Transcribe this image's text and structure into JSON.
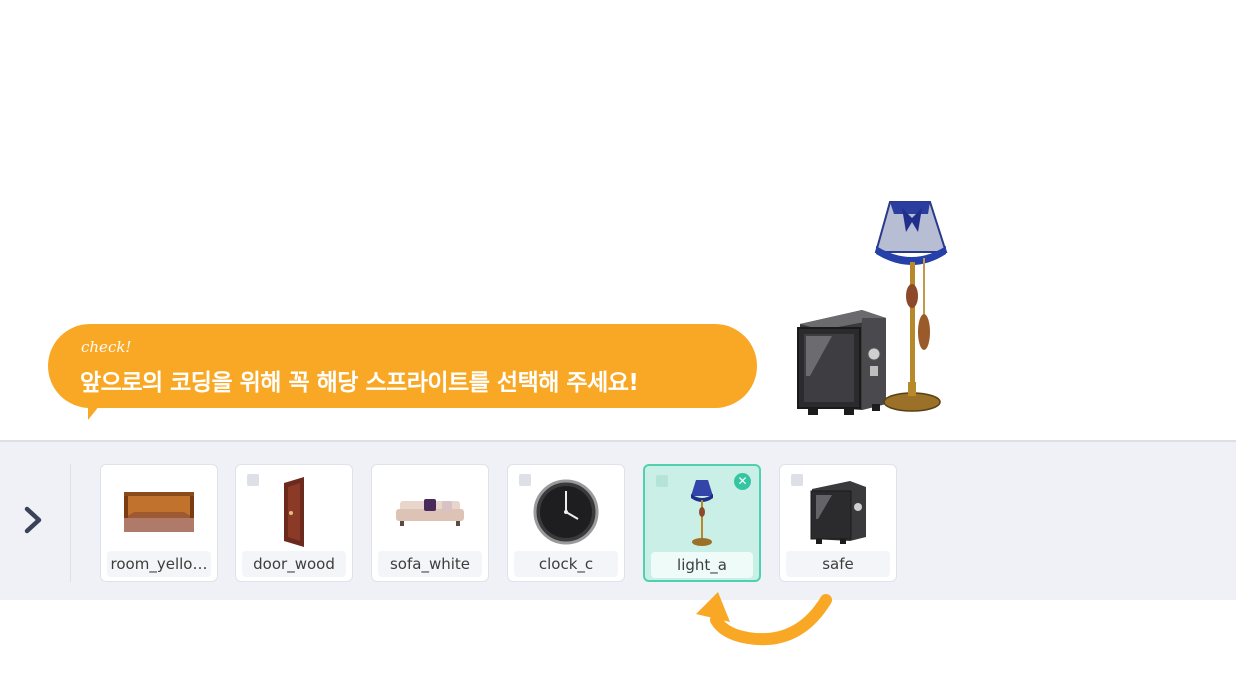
{
  "bubble": {
    "check_label": "check!",
    "message": "앞으로의 코딩을 위해 꼭 해당 스프라이트를 선택해 주세요!"
  },
  "sprites": [
    {
      "name": "room_yello…",
      "icon": "room-thumbnail-icon",
      "selected": false
    },
    {
      "name": "door_wood",
      "icon": "door-thumbnail-icon",
      "selected": false
    },
    {
      "name": "sofa_white",
      "icon": "sofa-thumbnail-icon",
      "selected": false
    },
    {
      "name": "clock_c",
      "icon": "clock-thumbnail-icon",
      "selected": false
    },
    {
      "name": "light_a",
      "icon": "lamp-thumbnail-icon",
      "selected": true
    },
    {
      "name": "safe",
      "icon": "safe-thumbnail-icon",
      "selected": false
    }
  ],
  "colors": {
    "bubble": "#f9a825",
    "selected_card": "#c9efe7",
    "selected_border": "#4fd1b0",
    "bar_background": "#eff1f6",
    "hint_arrow": "#f9a825"
  }
}
